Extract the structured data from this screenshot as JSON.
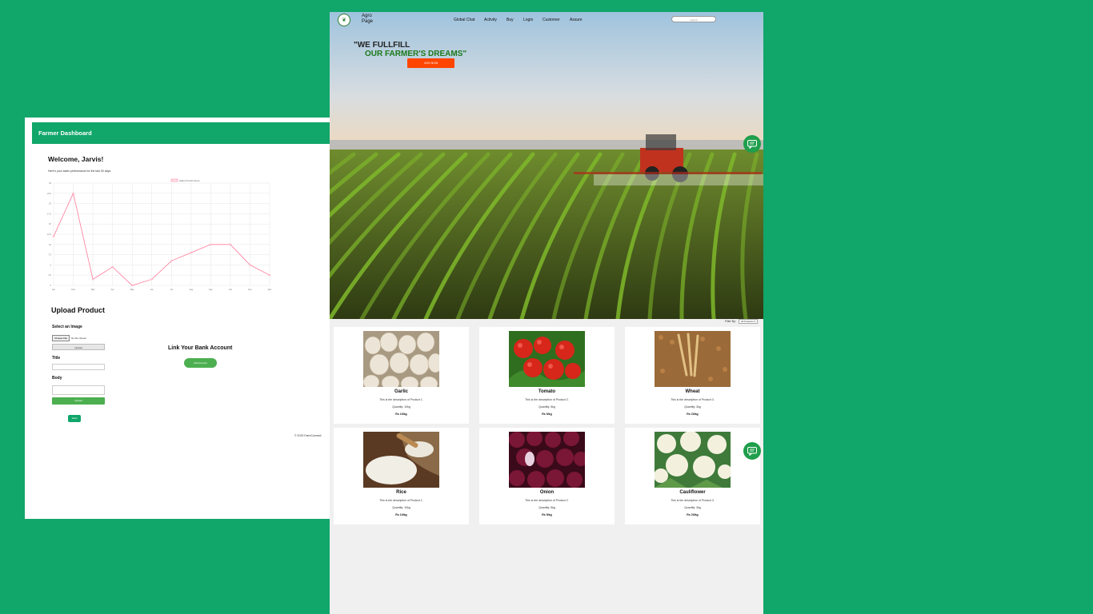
{
  "dashboard": {
    "header_title": "Farmer Dashboard",
    "welcome": "Welcome, Jarvis!",
    "performance_text": "Here's your sales performance for the last 30 days:",
    "upload": {
      "title": "Upload Product",
      "select_label": "Select an Image",
      "choose_file": "Choose File",
      "no_file": "No file chosen",
      "upload_button": "Upload",
      "title_label": "Title",
      "body_label": "Body",
      "submit_button": "Upload"
    },
    "save_button": "Save",
    "bank": {
      "title": "Link Your Bank Account",
      "button": "Add Account"
    },
    "copyright": "© 2023 FarmConnect"
  },
  "chart_data": {
    "type": "line",
    "legend": "Sales Performance",
    "categories": [
      "Jan",
      "Feb",
      "Mar",
      "Apr",
      "May",
      "Jun",
      "Jul",
      "Aug",
      "Sep",
      "Oct",
      "Nov",
      "Dec"
    ],
    "values": [
      12,
      22.5,
      1.5,
      4.5,
      0,
      1.5,
      6,
      8,
      10,
      10,
      5,
      2.5
    ],
    "ylim": [
      0,
      25
    ],
    "yticks": [
      0,
      2.5,
      5,
      7.5,
      10,
      12.5,
      15,
      17.5,
      20,
      22.5,
      25
    ],
    "color": "#ff7a9a",
    "grid": true
  },
  "agro": {
    "brand": "Agro Page",
    "nav": [
      "Global Chat",
      "Activity",
      "Buy",
      "Login",
      "Customer",
      "Assure"
    ],
    "search_placeholder": "search",
    "tagline_1": "\"WE FULLFILL",
    "tagline_2": "OUR FARMER'S DREAMS\"",
    "join_button": "JOIN NOW",
    "filter_label": "Filter By:",
    "filter_value": "All Products",
    "products": [
      {
        "name": "Garlic",
        "desc": "This is the description of Product 1.",
        "qty": "Quantity: 10kg",
        "price": "Rs 10/kg"
      },
      {
        "name": "Tomato",
        "desc": "This is the description of Product 2.",
        "qty": "Quantity: 5kg",
        "price": "Rs 5/kg"
      },
      {
        "name": "Wheat",
        "desc": "This is the description of Product 3.",
        "qty": "Quantity: 3kg",
        "price": "Rs 20/kg"
      },
      {
        "name": "Rice",
        "desc": "This is the description of Product 1.",
        "qty": "Quantity: 10kg",
        "price": "Rs 10/kg"
      },
      {
        "name": "Onion",
        "desc": "This is the description of Product 2.",
        "qty": "Quantity: 5kg",
        "price": "Rs 5/kg"
      },
      {
        "name": "Cauliflower",
        "desc": "This is the description of Product 3.",
        "qty": "Quantity: 3kg",
        "price": "Rs 20/kg"
      }
    ],
    "icons": {
      "chat": "chat-icon",
      "logo": "leaf-logo-icon"
    },
    "colors": {
      "brand_green": "#11a66a",
      "join_orange": "#ff4500",
      "tag_green": "#1b7a1b"
    }
  }
}
